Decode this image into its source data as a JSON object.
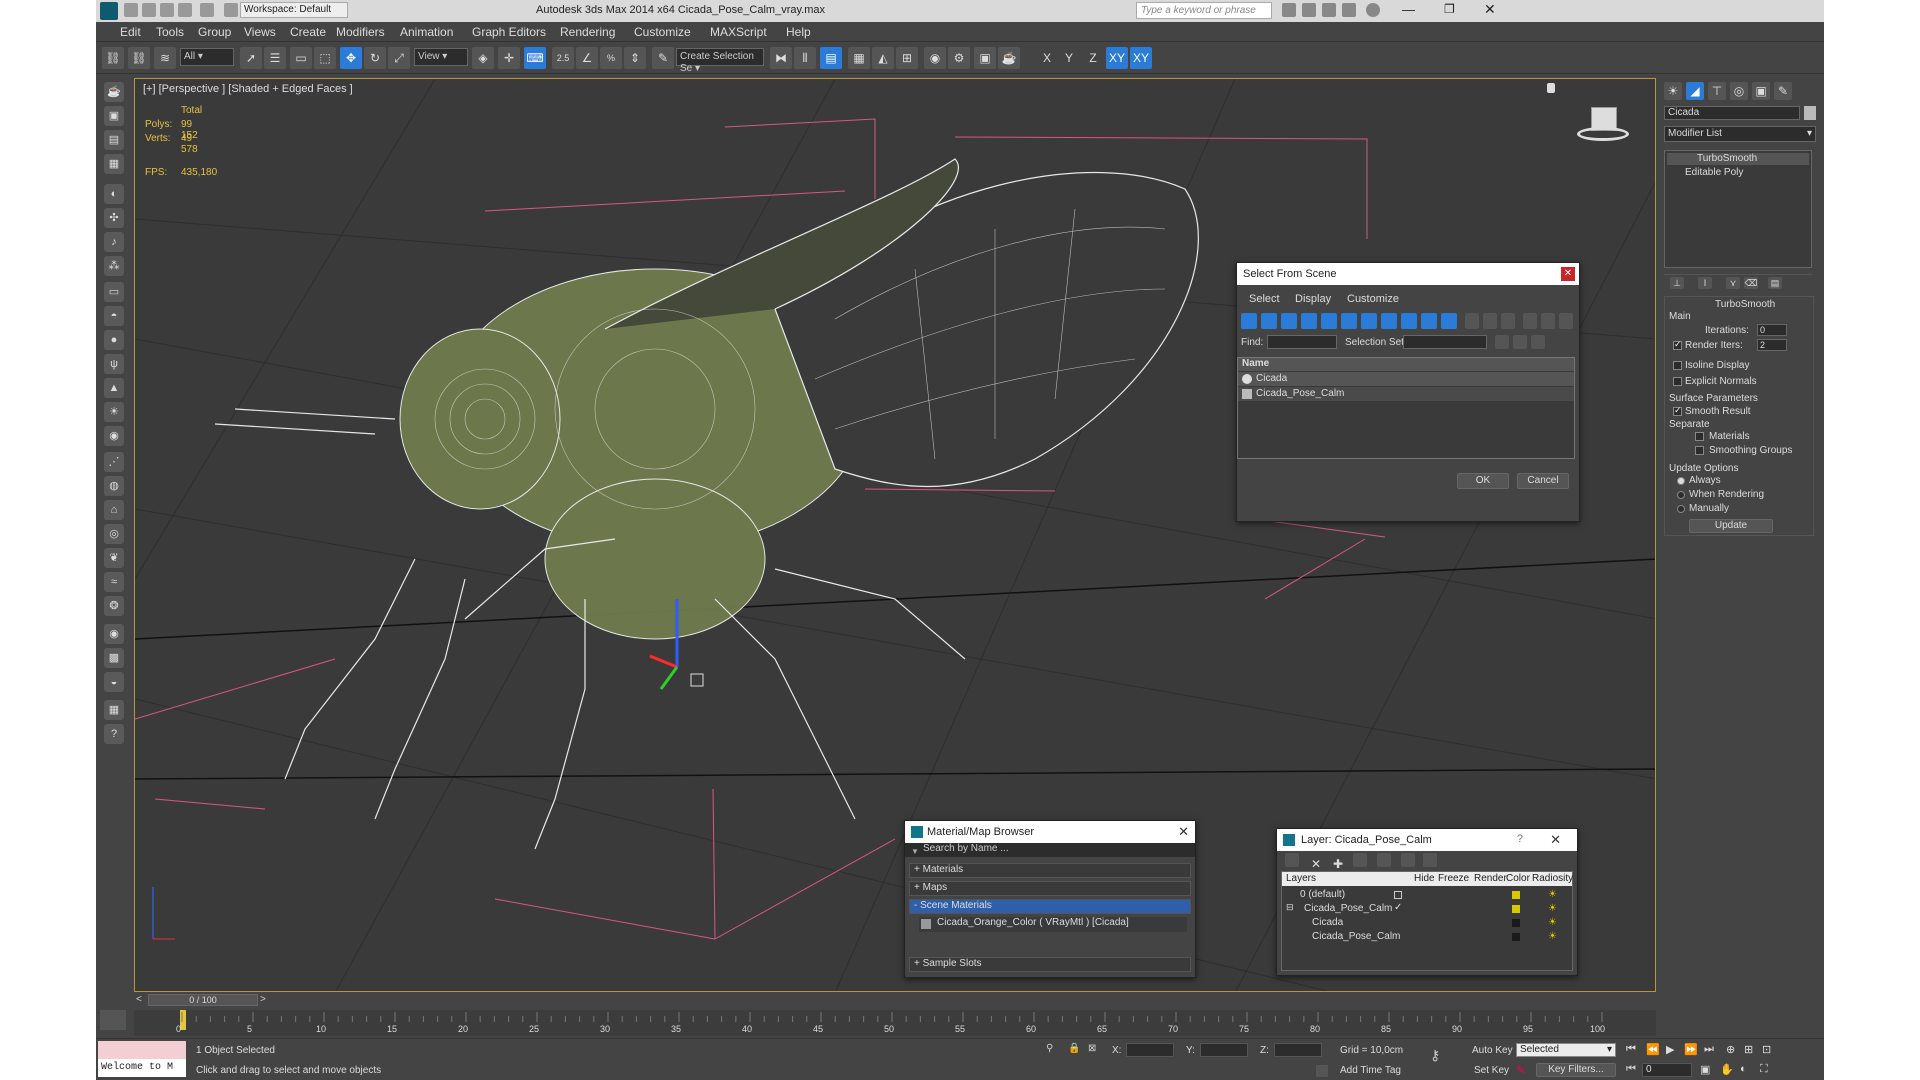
{
  "window": {
    "title": "Autodesk 3ds Max  2014 x64     Cicada_Pose_Calm_vray.max",
    "workspace": "Workspace: Default",
    "search_placeholder": "Type a keyword or phrase"
  },
  "menu": [
    "Edit",
    "Tools",
    "Group",
    "Views",
    "Create",
    "Modifiers",
    "Animation",
    "Graph Editors",
    "Rendering",
    "Customize",
    "MAXScript",
    "Help"
  ],
  "toolbar": {
    "filter": "All",
    "ref_coord": "View",
    "angle_snap": "2.5",
    "named_sel": "Create Selection Se",
    "axis": [
      "X",
      "Y",
      "Z",
      "XY",
      "XY"
    ]
  },
  "viewport": {
    "label": "[+] [Perspective ] [Shaded + Edged Faces ]",
    "stats": {
      "total": "Total",
      "polys_label": "Polys:",
      "polys": "99 152",
      "verts_label": "Verts:",
      "verts": "49 578",
      "fps_label": "FPS:",
      "fps": "435,180"
    }
  },
  "select_dialog": {
    "title": "Select From Scene",
    "menu": [
      "Select",
      "Display",
      "Customize"
    ],
    "find_label": "Find:",
    "selset_label": "Selection Set:",
    "col_name": "Name",
    "items": [
      "Cicada",
      "Cicada_Pose_Calm"
    ],
    "ok": "OK",
    "cancel": "Cancel"
  },
  "material_browser": {
    "title": "Material/Map Browser",
    "search": "Search by Name ...",
    "sections": [
      "+ Materials",
      "+ Maps",
      "- Scene Materials"
    ],
    "scene_item": "Cicada_Orange_Color  ( VRayMtl )  [Cicada]",
    "sample": "+ Sample Slots"
  },
  "layer_dialog": {
    "title": "Layer: Cicada_Pose_Calm",
    "help": "?",
    "cols": [
      "Layers",
      "Hide",
      "Freeze",
      "Render",
      "Color",
      "Radiosity"
    ],
    "rows": [
      {
        "name": "0 (default)",
        "color": "#d8c800"
      },
      {
        "name": "Cicada_Pose_Calm",
        "color": "#d8c800"
      },
      {
        "name": "Cicada",
        "color": "#1a1a1a"
      },
      {
        "name": "Cicada_Pose_Calm",
        "color": "#1a1a1a"
      }
    ]
  },
  "command_panel": {
    "object_name": "Cicada",
    "modifier_list": "Modifier List",
    "stack": [
      "TurboSmooth",
      "Editable Poly"
    ],
    "rollout": "TurboSmooth",
    "main": "Main",
    "iterations_label": "Iterations:",
    "iterations": "0",
    "render_iters_label": "Render Iters:",
    "render_iters": "2",
    "isoline": "Isoline Display",
    "explicit": "Explicit Normals",
    "surface": "Surface Parameters",
    "smooth_result": "Smooth Result",
    "separate": "Separate",
    "materials": "Materials",
    "smoothing": "Smoothing Groups",
    "update_opts": "Update Options",
    "always": "Always",
    "when_rendering": "When Rendering",
    "manually": "Manually",
    "update_btn": "Update"
  },
  "timeline": {
    "frame": "0 / 100",
    "ticks": [
      "0",
      "5",
      "10",
      "15",
      "20",
      "25",
      "30",
      "35",
      "40",
      "45",
      "50",
      "55",
      "60",
      "65",
      "70",
      "75",
      "80",
      "85",
      "90",
      "95",
      "100"
    ]
  },
  "status": {
    "welcome": "Welcome to M",
    "selected": "1 Object Selected",
    "hint": "Click and drag to select and move objects",
    "x": "X:",
    "y": "Y:",
    "z": "Z:",
    "grid": "Grid = 10,0cm",
    "add_tag": "Add Time Tag",
    "auto_key": "Auto Key",
    "set_key": "Set Key",
    "key_mode": "Selected",
    "key_filters": "Key Filters...",
    "frame_field": "0"
  }
}
